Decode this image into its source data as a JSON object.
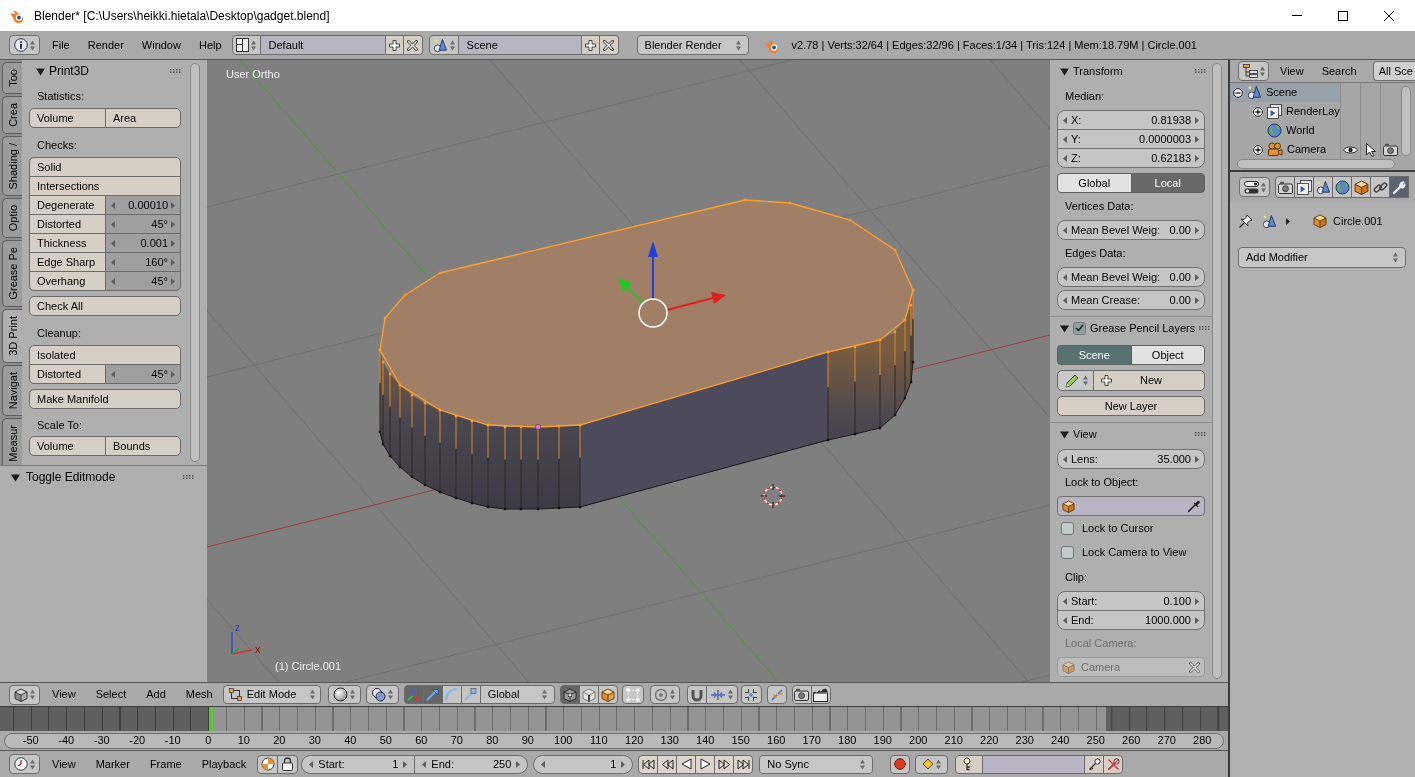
{
  "window": {
    "title": "Blender* [C:\\Users\\heikki.hietala\\Desktop\\gadget.blend]"
  },
  "info_header": {
    "menus": [
      "File",
      "Render",
      "Window",
      "Help"
    ],
    "layout": "Default",
    "scene": "Scene",
    "engine": "Blender Render",
    "stats": "v2.78 | Verts:32/64 | Edges:32/96 | Faces:1/34 | Tris:124 | Mem:18.79M | Circle.001"
  },
  "tool_shelf": {
    "tabs": [
      {
        "label": "Too",
        "selected": false
      },
      {
        "label": "Crea",
        "selected": false
      },
      {
        "label": "Shading /",
        "selected": false
      },
      {
        "label": "Optio",
        "selected": false
      },
      {
        "label": "Grease Pe",
        "selected": false
      },
      {
        "label": "3D Print",
        "selected": true
      },
      {
        "label": "Navigat",
        "selected": false
      },
      {
        "label": "Measur",
        "selected": false
      }
    ],
    "panel": {
      "title": "Print3D",
      "expanded": true,
      "rows": [
        {
          "kind": "label",
          "text": "Statistics:"
        },
        {
          "kind": "group",
          "items": [
            {
              "kind": "split",
              "labels": [
                "Volume",
                "Area"
              ]
            }
          ]
        },
        {
          "kind": "label",
          "text": "Checks:"
        },
        {
          "kind": "group",
          "items": [
            {
              "kind": "button",
              "label": "Solid"
            },
            {
              "kind": "button",
              "label": "Intersections"
            },
            {
              "kind": "number",
              "label": "Degenerate",
              "value": "0.00010"
            },
            {
              "kind": "number",
              "label": "Distorted",
              "value": "45°"
            },
            {
              "kind": "number",
              "label": "Thickness",
              "value": "0.001"
            },
            {
              "kind": "number",
              "label": "Edge Sharp",
              "value": "160°"
            },
            {
              "kind": "number",
              "label": "Overhang",
              "value": "45°"
            }
          ]
        },
        {
          "kind": "group",
          "items": [
            {
              "kind": "button",
              "label": "Check All"
            }
          ]
        },
        {
          "kind": "label",
          "text": "Cleanup:"
        },
        {
          "kind": "group",
          "items": [
            {
              "kind": "button",
              "label": "Isolated"
            },
            {
              "kind": "number",
              "label": "Distorted",
              "value": "45°"
            }
          ]
        },
        {
          "kind": "group",
          "items": [
            {
              "kind": "button",
              "label": "Make Manifold"
            }
          ]
        },
        {
          "kind": "label",
          "text": "Scale To:"
        },
        {
          "kind": "group",
          "items": [
            {
              "kind": "split",
              "labels": [
                "Volume",
                "Bounds"
              ]
            }
          ]
        }
      ]
    }
  },
  "last_operator": {
    "title": "Toggle Editmode",
    "expanded": true
  },
  "viewport": {
    "view_name": "User Ortho",
    "object_info": "(1) Circle.001",
    "axis_labels": [
      "x",
      "z"
    ]
  },
  "properties_region": {
    "panels": [
      {
        "title": "Transform",
        "expanded": true,
        "rows": [
          {
            "kind": "label",
            "text": "Median:",
            "disabled": false
          },
          {
            "kind": "fields",
            "items": [
              {
                "label": "X:",
                "value": "0.81938"
              },
              {
                "label": "Y:",
                "value": "0.0000003"
              },
              {
                "label": "Z:",
                "value": "0.62183"
              }
            ]
          },
          {
            "kind": "toggle",
            "options": [
              {
                "label": "Global",
                "selected": false
              },
              {
                "label": "Local",
                "selected": true
              }
            ]
          },
          {
            "kind": "label",
            "text": "Vertices Data:",
            "disabled": false
          },
          {
            "kind": "fields",
            "items": [
              {
                "label": "Mean Bevel Weig:",
                "value": "0.00"
              }
            ]
          },
          {
            "kind": "label",
            "text": "Edges Data:",
            "disabled": false
          },
          {
            "kind": "fields",
            "items": [
              {
                "label": "Mean Bevel Weig:",
                "value": "0.00"
              }
            ]
          },
          {
            "kind": "fields",
            "items": [
              {
                "label": "Mean Crease:",
                "value": "0.00"
              }
            ]
          }
        ]
      },
      {
        "title": "Grease Pencil Layers",
        "expanded": true,
        "checked": true,
        "rows": [
          {
            "kind": "source_tabs",
            "options": [
              {
                "label": "Scene",
                "selected": true
              },
              {
                "label": "Object",
                "selected": false
              }
            ]
          },
          {
            "kind": "datablock",
            "label": "New"
          },
          {
            "kind": "button",
            "label": "New Layer"
          }
        ]
      },
      {
        "title": "View",
        "expanded": true,
        "rows": [
          {
            "kind": "fields",
            "items": [
              {
                "label": "Lens:",
                "value": "35.000"
              }
            ]
          },
          {
            "kind": "label",
            "text": "Lock to Object:",
            "disabled": false
          },
          {
            "kind": "object_field",
            "disabled": false
          },
          {
            "kind": "checkbox",
            "label": "Lock to Cursor",
            "checked": false
          },
          {
            "kind": "checkbox",
            "label": "Lock Camera to View",
            "checked": false
          },
          {
            "kind": "label",
            "text": "Clip:",
            "disabled": false
          },
          {
            "kind": "fields",
            "items": [
              {
                "label": "Start:",
                "value": "0.100"
              },
              {
                "label": "End:",
                "value": "1000.000"
              }
            ]
          },
          {
            "kind": "label",
            "text": "Local Camera:",
            "disabled": true
          },
          {
            "kind": "object_field",
            "value": "Camera",
            "disabled": true
          }
        ]
      }
    ]
  },
  "outliner": {
    "menus": [
      "View",
      "Search"
    ],
    "filter": "All Sce",
    "tree": [
      {
        "label": "Scene",
        "kind": "scene",
        "expanded": true,
        "selected": true,
        "restrict": false,
        "children": [
          {
            "label": "RenderLay",
            "kind": "render_layers",
            "expanded": false,
            "selected": false,
            "restrict": false
          },
          {
            "label": "World",
            "kind": "world",
            "selected": false,
            "restrict": false
          },
          {
            "label": "Camera",
            "kind": "camera",
            "expanded": false,
            "selected": false,
            "restrict": true
          }
        ]
      }
    ]
  },
  "properties_editor": {
    "tabs": [
      {
        "kind": "render",
        "selected": false
      },
      {
        "kind": "render_layers",
        "selected": false
      },
      {
        "kind": "scene",
        "selected": false
      },
      {
        "kind": "world",
        "selected": false
      },
      {
        "kind": "object",
        "selected": false
      },
      {
        "kind": "constraints",
        "selected": false
      },
      {
        "kind": "modifiers",
        "selected": true
      }
    ],
    "breadcrumb": "Circle.001",
    "add_modifier": "Add Modifier"
  },
  "view3d_header": {
    "menus": [
      "View",
      "Select",
      "Add",
      "Mesh"
    ],
    "mode": "Edit Mode",
    "manipulators": [
      {
        "kind": "axes",
        "selected": true
      },
      {
        "kind": "translate",
        "selected": true
      },
      {
        "kind": "rotate",
        "selected": false
      },
      {
        "kind": "scale",
        "selected": false
      }
    ],
    "orientation": "Global",
    "select_modes": [
      {
        "kind": "vertex",
        "selected": true
      },
      {
        "kind": "edge",
        "selected": false
      },
      {
        "kind": "face",
        "selected": false
      }
    ]
  },
  "timeline": {
    "ruler": [
      "-50",
      "-40",
      "-30",
      "-20",
      "-10",
      "0",
      "10",
      "20",
      "30",
      "40",
      "50",
      "60",
      "70",
      "80",
      "90",
      "100",
      "110",
      "120",
      "130",
      "140",
      "150",
      "160",
      "170",
      "180",
      "190",
      "200",
      "210",
      "220",
      "230",
      "240",
      "250",
      "260",
      "270",
      "280"
    ]
  },
  "timeline_header": {
    "menus": [
      "View",
      "Marker",
      "Frame",
      "Playback"
    ],
    "start_label": "Start:",
    "start": "1",
    "end_label": "End:",
    "end": "250",
    "current_frame": "1",
    "sync": "No Sync"
  }
}
